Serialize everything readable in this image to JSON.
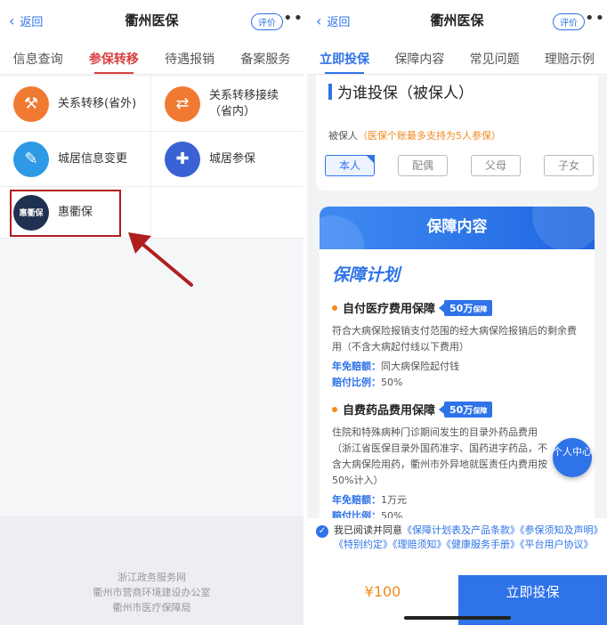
{
  "left": {
    "header": {
      "back_label": "返回",
      "title": "衢州医保",
      "rate_label": "评价",
      "more": "•••"
    },
    "tabs": [
      {
        "label": "信息查询"
      },
      {
        "label": "参保转移"
      },
      {
        "label": "待遇报销"
      },
      {
        "label": "备案服务"
      }
    ],
    "grid": [
      {
        "label": "关系转移(省外)",
        "icon": "worker-transfer-icon"
      },
      {
        "label": "关系转移接续\n（省内）",
        "icon": "person-transfer-icon"
      },
      {
        "label": "城居信息变更",
        "icon": "user-edit-icon"
      },
      {
        "label": "城居参保",
        "icon": "user-insure-icon"
      },
      {
        "label": "惠衢保",
        "icon": "huiqubao-logo",
        "logo_text": "惠衢保"
      }
    ],
    "footer": [
      "浙江政务服务网",
      "衢州市营商环境建设办公室",
      "衢州市医疗保障局"
    ]
  },
  "right": {
    "header": {
      "back_label": "返回",
      "title": "衢州医保",
      "rate_label": "评价",
      "more": "•••"
    },
    "tabs": [
      {
        "label": "立即投保"
      },
      {
        "label": "保障内容"
      },
      {
        "label": "常见问题"
      },
      {
        "label": "理赔示例"
      }
    ],
    "section_title": "为谁投保（被保人）",
    "insured_label": "被保人",
    "insured_note": "（医保个账最多支持为5人参保）",
    "relations": [
      "本人",
      "配偶",
      "父母",
      "子女"
    ],
    "coverage_title": "保障内容",
    "plan_title": "保障计划",
    "items": [
      {
        "name": "自付医疗费用保障",
        "amount": "50万",
        "amount_unit": "保障",
        "desc": "符合大病保险报销支付范围的经大病保险报销后的剩余费用（不含大病起付线以下费用）",
        "deductible_label": "年免赔额：",
        "deductible": "同大病保险起付钱",
        "ratio_label": "赔付比例：",
        "ratio": "50%"
      },
      {
        "name": "自费药品费用保障",
        "amount": "50万",
        "amount_unit": "保障",
        "desc": "住院和特殊病种门诊期间发生的目录外药品费用（浙江省医保目录外国药准字、国药进字药品，不含大病保险用药，衢州市外异地就医责任内费用按50%计入）",
        "deductible_label": "年免赔额：",
        "deductible": "1万元",
        "ratio_label": "赔付比例：",
        "ratio": "50%"
      }
    ],
    "float_button": "个人中心",
    "agree_prefix": "我已阅读并同意",
    "agree_links": "《保障计划表及产品条款》《参保须知及声明》《特别约定》《理赔须知》《健康服务手册》《平台用户协议》",
    "price": "¥100",
    "buy_label": "立即投保"
  },
  "colors": {
    "accent": "#2f73e8",
    "highlight_box": "#b01e1e",
    "orange": "#f07a32"
  }
}
